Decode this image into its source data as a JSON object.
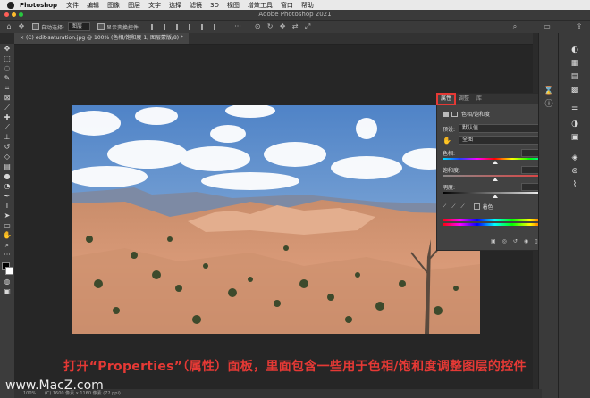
{
  "menubar": {
    "app_name": "Photoshop",
    "items": [
      "文件",
      "编辑",
      "图像",
      "图层",
      "文字",
      "选择",
      "滤镜",
      "3D",
      "视图",
      "增效工具",
      "窗口",
      "帮助"
    ]
  },
  "window": {
    "title": "Adobe Photoshop 2021"
  },
  "options_bar": {
    "auto_select_label": "自动选择:",
    "auto_select_value": "图层",
    "show_transform_label": "显示变换控件"
  },
  "document_tab": {
    "label": "(C) edit-saturation.jpg @ 100% (色相/饱和度 1, 图层蒙版/8) *"
  },
  "properties_panel": {
    "tabs": [
      "属性",
      "调整",
      "库"
    ],
    "header": "色相/饱和度",
    "preset_label": "预设:",
    "preset_value": "默认值",
    "channel_value": "全图",
    "hue": {
      "label": "色相:",
      "value": "0"
    },
    "saturation": {
      "label": "饱和度:",
      "value": "0"
    },
    "lightness": {
      "label": "明度:",
      "value": "0"
    },
    "colorize_label": "着色"
  },
  "status_bar": {
    "zoom": "100%",
    "doc_size": "(C) 1600 像素 x 1160 像素 (72 ppi)"
  },
  "caption": {
    "text": "打开“Properties”（属性）面板，里面包含一些用于色相/饱和度调整图层的控件"
  },
  "watermark": {
    "text": "www.MacZ.com"
  },
  "colors": {
    "caption": "#e53935",
    "highlight": "#e53935"
  }
}
